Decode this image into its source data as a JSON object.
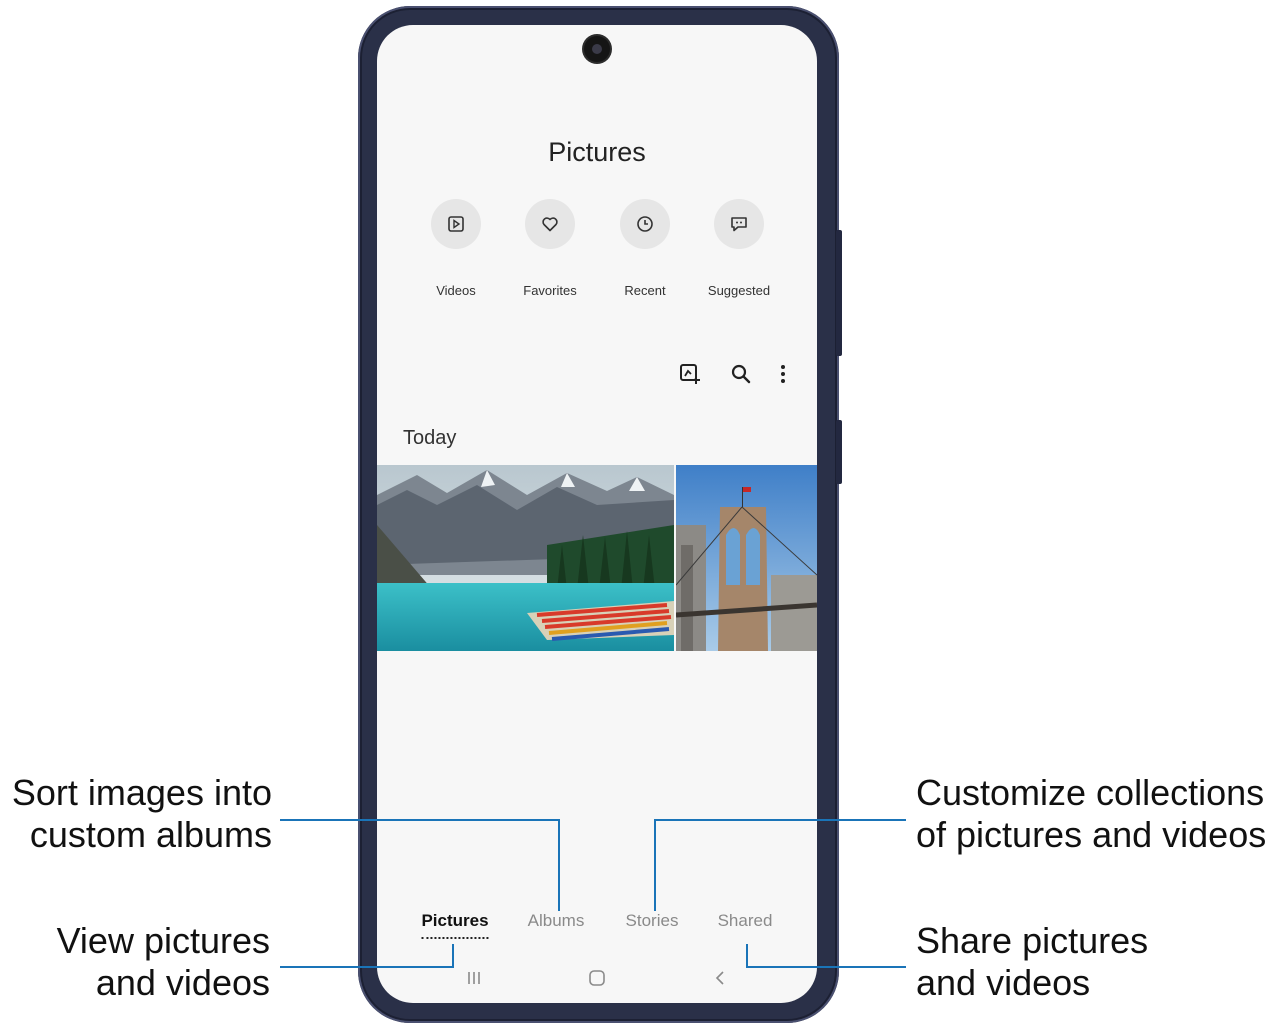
{
  "screen": {
    "title": "Pictures",
    "quick_actions": [
      {
        "label": "Videos",
        "icon": "video-play-icon"
      },
      {
        "label": "Favorites",
        "icon": "heart-icon"
      },
      {
        "label": "Recent",
        "icon": "clock-icon"
      },
      {
        "label": "Suggested",
        "icon": "suggested-chat-icon"
      }
    ],
    "toolbar_icons": [
      "create-icon",
      "search-icon",
      "more-options-icon"
    ],
    "section_header": "Today",
    "photos": [
      "mountain-lake-photo",
      "bridge-photo"
    ],
    "tabs": [
      {
        "label": "Pictures",
        "active": true
      },
      {
        "label": "Albums",
        "active": false
      },
      {
        "label": "Stories",
        "active": false
      },
      {
        "label": "Shared",
        "active": false
      }
    ],
    "nav_icons": [
      "recent-apps-icon",
      "home-icon",
      "back-icon"
    ]
  },
  "callouts": {
    "albums": {
      "line1": "Sort images into",
      "line2": "custom albums"
    },
    "pictures": {
      "line1": "View pictures",
      "line2": "and videos"
    },
    "stories": {
      "line1": "Customize collections",
      "line2": "of pictures and videos"
    },
    "shared": {
      "line1": "Share pictures",
      "line2": "and videos"
    }
  },
  "colors": {
    "callout_line": "#1a74b8",
    "phone_frame": "#1c2033",
    "screen_bg": "#f7f7f7"
  }
}
